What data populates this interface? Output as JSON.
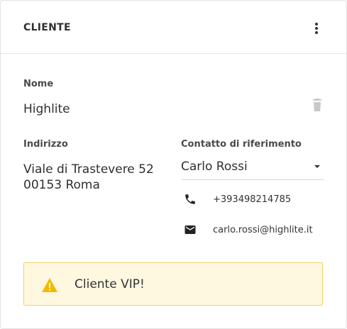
{
  "header": {
    "title": "CLIENTE",
    "menu_icon": "more-vertical-icon"
  },
  "nome": {
    "label": "Nome",
    "value": "Highlite",
    "delete_icon": "trash-icon"
  },
  "indirizzo": {
    "label": "Indirizzo",
    "line1": "Viale di Trastevere 52",
    "line2": "00153 Roma"
  },
  "contatto": {
    "label": "Contatto di riferimento",
    "selected": "Carlo Rossi",
    "dropdown_icon": "caret-down-icon",
    "phone_icon": "phone-icon",
    "phone": "+393498214785",
    "email_icon": "mail-icon",
    "email": "carlo.rossi@highlite.it"
  },
  "alert": {
    "icon": "warning-icon",
    "text": "Cliente VIP!",
    "icon_color": "#f5b800",
    "background": "#fff8e0",
    "border": "#f2d35e"
  }
}
